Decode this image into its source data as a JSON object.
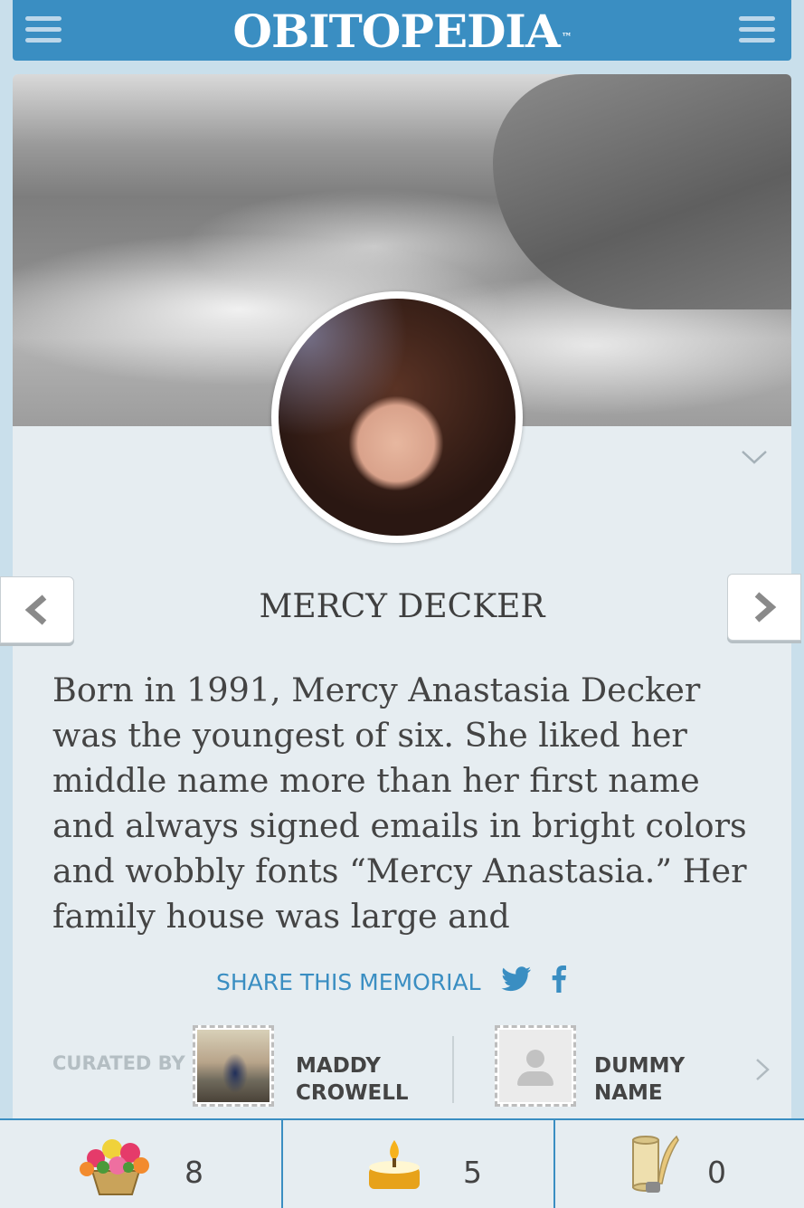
{
  "header": {
    "logo_text": "OBITOPEDIA",
    "trademark": "™"
  },
  "memorial": {
    "name": "MERCY DECKER",
    "bio": "Born in 1991, Mercy Anastasia Decker was the youngest of six. She liked her middle name more than her first name and always signed emails in bright colors and wobbly fonts “Mercy Anastasia.” Her family house was large and"
  },
  "share": {
    "label": "SHARE THIS MEMORIAL",
    "icons": [
      "twitter-icon",
      "facebook-icon"
    ]
  },
  "curators": {
    "label": "CURATED BY",
    "items": [
      {
        "first": "MADDY",
        "last": "CROWELL"
      },
      {
        "first": "DUMMY",
        "last": "NAME"
      }
    ]
  },
  "tributes": [
    {
      "icon": "flowers-icon",
      "count": "8"
    },
    {
      "icon": "candle-icon",
      "count": "5"
    },
    {
      "icon": "scroll-icon",
      "count": "0"
    }
  ],
  "colors": {
    "brand_blue": "#3a8ec2",
    "page_bg": "#c9dfeb",
    "card_bg": "#e6edf1",
    "text": "#444444"
  }
}
